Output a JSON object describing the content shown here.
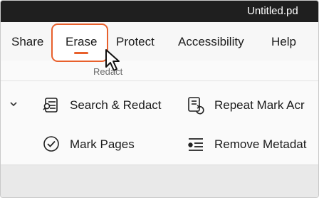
{
  "window": {
    "title": "Untitled.pd"
  },
  "menu": {
    "tabs": [
      {
        "label": "Share"
      },
      {
        "label": "Erase"
      },
      {
        "label": "Protect"
      },
      {
        "label": "Accessibility"
      },
      {
        "label": "Help"
      }
    ],
    "active_tab": "Erase",
    "accent_color": "#e8602c"
  },
  "ribbon": {
    "group_label": "Redact",
    "commands": [
      {
        "label": "Search & Redact",
        "icon": "search-redact-icon"
      },
      {
        "label": "Repeat Mark Acr",
        "icon": "repeat-mark-icon"
      },
      {
        "label": "Mark Pages",
        "icon": "check-circle-icon"
      },
      {
        "label": "Remove Metadat",
        "icon": "remove-metadata-icon"
      }
    ]
  }
}
